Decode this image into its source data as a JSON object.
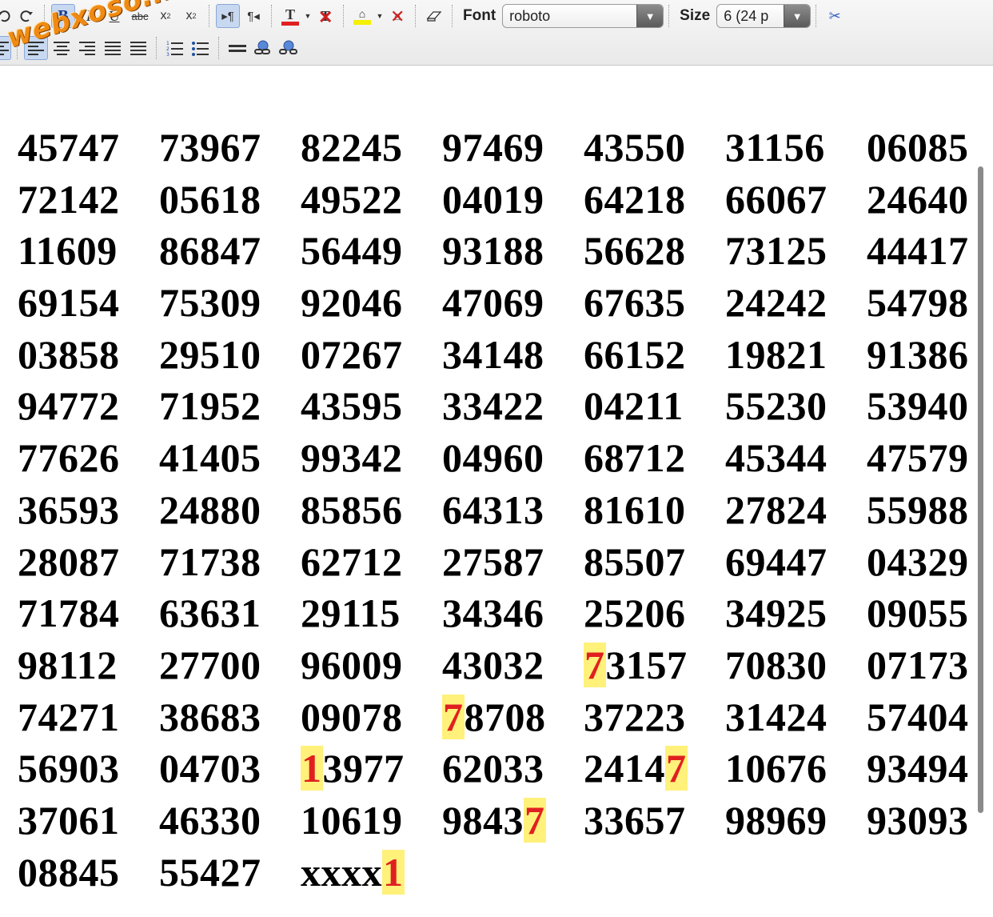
{
  "toolbar": {
    "font_label": "Font",
    "font_value": "roboto",
    "size_label": "Size",
    "size_value": "6 (24 p",
    "row1_icons": [
      "undo-icon",
      "redo-icon",
      "bold-icon",
      "italic-icon",
      "underline-icon",
      "strikethrough-icon",
      "subscript-icon",
      "superscript-icon",
      "ltr-icon",
      "rtl-icon",
      "text-color-icon",
      "remove-text-color-icon",
      "highlight-color-icon",
      "remove-highlight-icon",
      "eraser-icon",
      "cut-icon"
    ],
    "row2_icons": [
      "align-left-icon",
      "align-center-icon",
      "align-right-icon",
      "justify-icon",
      "indent-icon",
      "ordered-list-icon",
      "unordered-list-icon",
      "horizontal-rule-icon",
      "link-icon",
      "unlink-icon"
    ],
    "text_color_accent": "#e02020",
    "highlight_accent": "#f5f000"
  },
  "watermark": "webxoso.net",
  "numbers": [
    [
      "45747",
      "73967",
      "82245",
      "97469",
      "43550",
      "31156",
      "06085"
    ],
    [
      "72142",
      "05618",
      "49522",
      "04019",
      "64218",
      "66067",
      "24640"
    ],
    [
      "11609",
      "86847",
      "56449",
      "93188",
      "56628",
      "73125",
      "44417"
    ],
    [
      "69154",
      "75309",
      "92046",
      "47069",
      "67635",
      "24242",
      "54798"
    ],
    [
      "03858",
      "29510",
      "07267",
      "34148",
      "66152",
      "19821",
      "91386"
    ],
    [
      "94772",
      "71952",
      "43595",
      "33422",
      "04211",
      "55230",
      "53940"
    ],
    [
      "77626",
      "41405",
      "99342",
      "04960",
      "68712",
      "45344",
      "47579"
    ],
    [
      "36593",
      "24880",
      "85856",
      "64313",
      "81610",
      "27824",
      "55988"
    ],
    [
      "28087",
      "71738",
      "62712",
      "27587",
      "85507",
      "69447",
      "04329"
    ],
    [
      "71784",
      "63631",
      "29115",
      "34346",
      "25206",
      "34925",
      "09055"
    ],
    [
      "98112",
      "27700",
      "96009",
      "43032",
      "73157",
      "70830",
      "07173"
    ],
    [
      "74271",
      "38683",
      "09078",
      "78708",
      "37223",
      "31424",
      "57404"
    ],
    [
      "56903",
      "04703",
      "13977",
      "62033",
      "24147",
      "10676",
      "93494"
    ],
    [
      "37061",
      "46330",
      "10619",
      "98437",
      "33657",
      "98969",
      "93093"
    ],
    [
      "08845",
      "55427",
      "xxxx1"
    ]
  ],
  "highlights": [
    {
      "row": 10,
      "col": 4,
      "char": 0
    },
    {
      "row": 11,
      "col": 3,
      "char": 0
    },
    {
      "row": 12,
      "col": 2,
      "char": 0
    },
    {
      "row": 12,
      "col": 4,
      "char": 4
    },
    {
      "row": 13,
      "col": 3,
      "char": 4
    },
    {
      "row": 14,
      "col": 2,
      "char": 4
    }
  ],
  "colors": {
    "highlight_bg": "#fff17a",
    "highlight_text": "#e02020",
    "watermark": "#f08a12"
  }
}
